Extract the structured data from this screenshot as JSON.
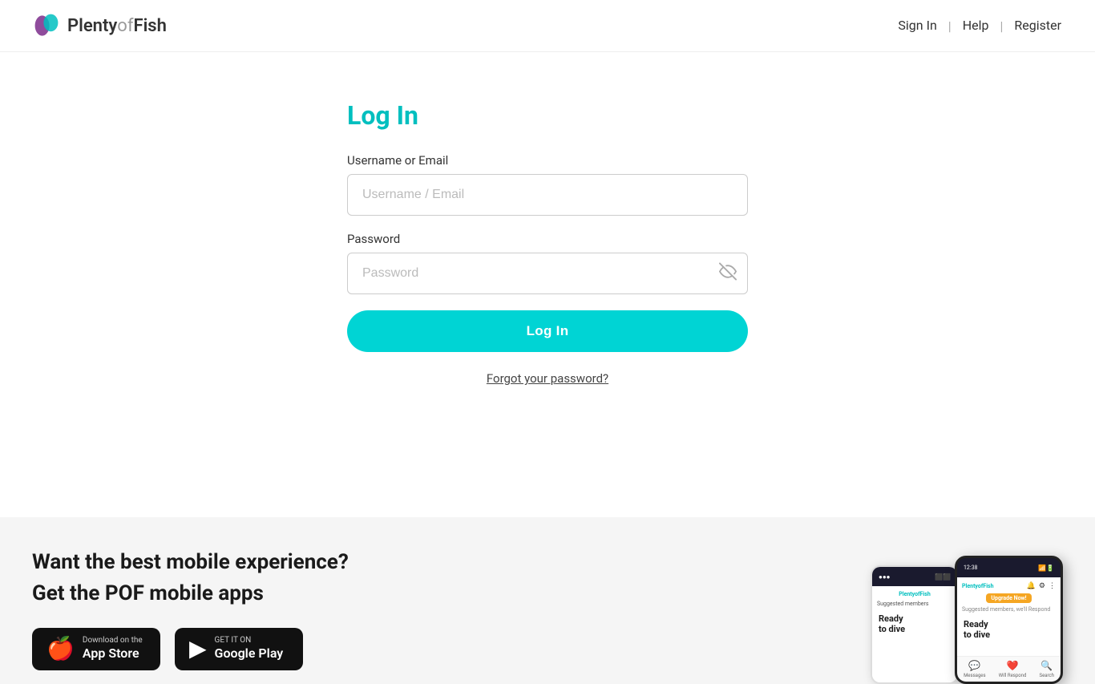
{
  "header": {
    "logo_text_plenty": "Plenty",
    "logo_text_of": "of",
    "logo_text_fish": "Fish",
    "nav": {
      "signin": "Sign In",
      "help": "Help",
      "register": "Register"
    }
  },
  "login": {
    "title": "Log In",
    "username_label": "Username or Email",
    "username_placeholder": "Username / Email",
    "password_label": "Password",
    "password_placeholder": "Password",
    "login_button": "Log In",
    "forgot_password": "Forgot your password?"
  },
  "footer": {
    "headline1": "Want the best mobile experience?",
    "headline2": "Get the POF mobile apps",
    "appstore": {
      "small_text": "Download on the",
      "big_text": "App Store"
    },
    "googleplay": {
      "small_text": "GET IT ON",
      "big_text": "Google Play"
    }
  },
  "phone": {
    "upgrade_label": "Upgrade Now!",
    "ready_text": "Ready\nto dive",
    "nav_items": [
      {
        "icon": "💬",
        "label": "Messages"
      },
      {
        "icon": "❤️",
        "label": "Will Respond"
      },
      {
        "icon": "🔍",
        "label": "Search"
      }
    ]
  },
  "colors": {
    "accent": "#00d4d4",
    "title_color": "#00bfbf",
    "dark": "#1a1a1a",
    "footer_bg": "#f5f5f5"
  }
}
